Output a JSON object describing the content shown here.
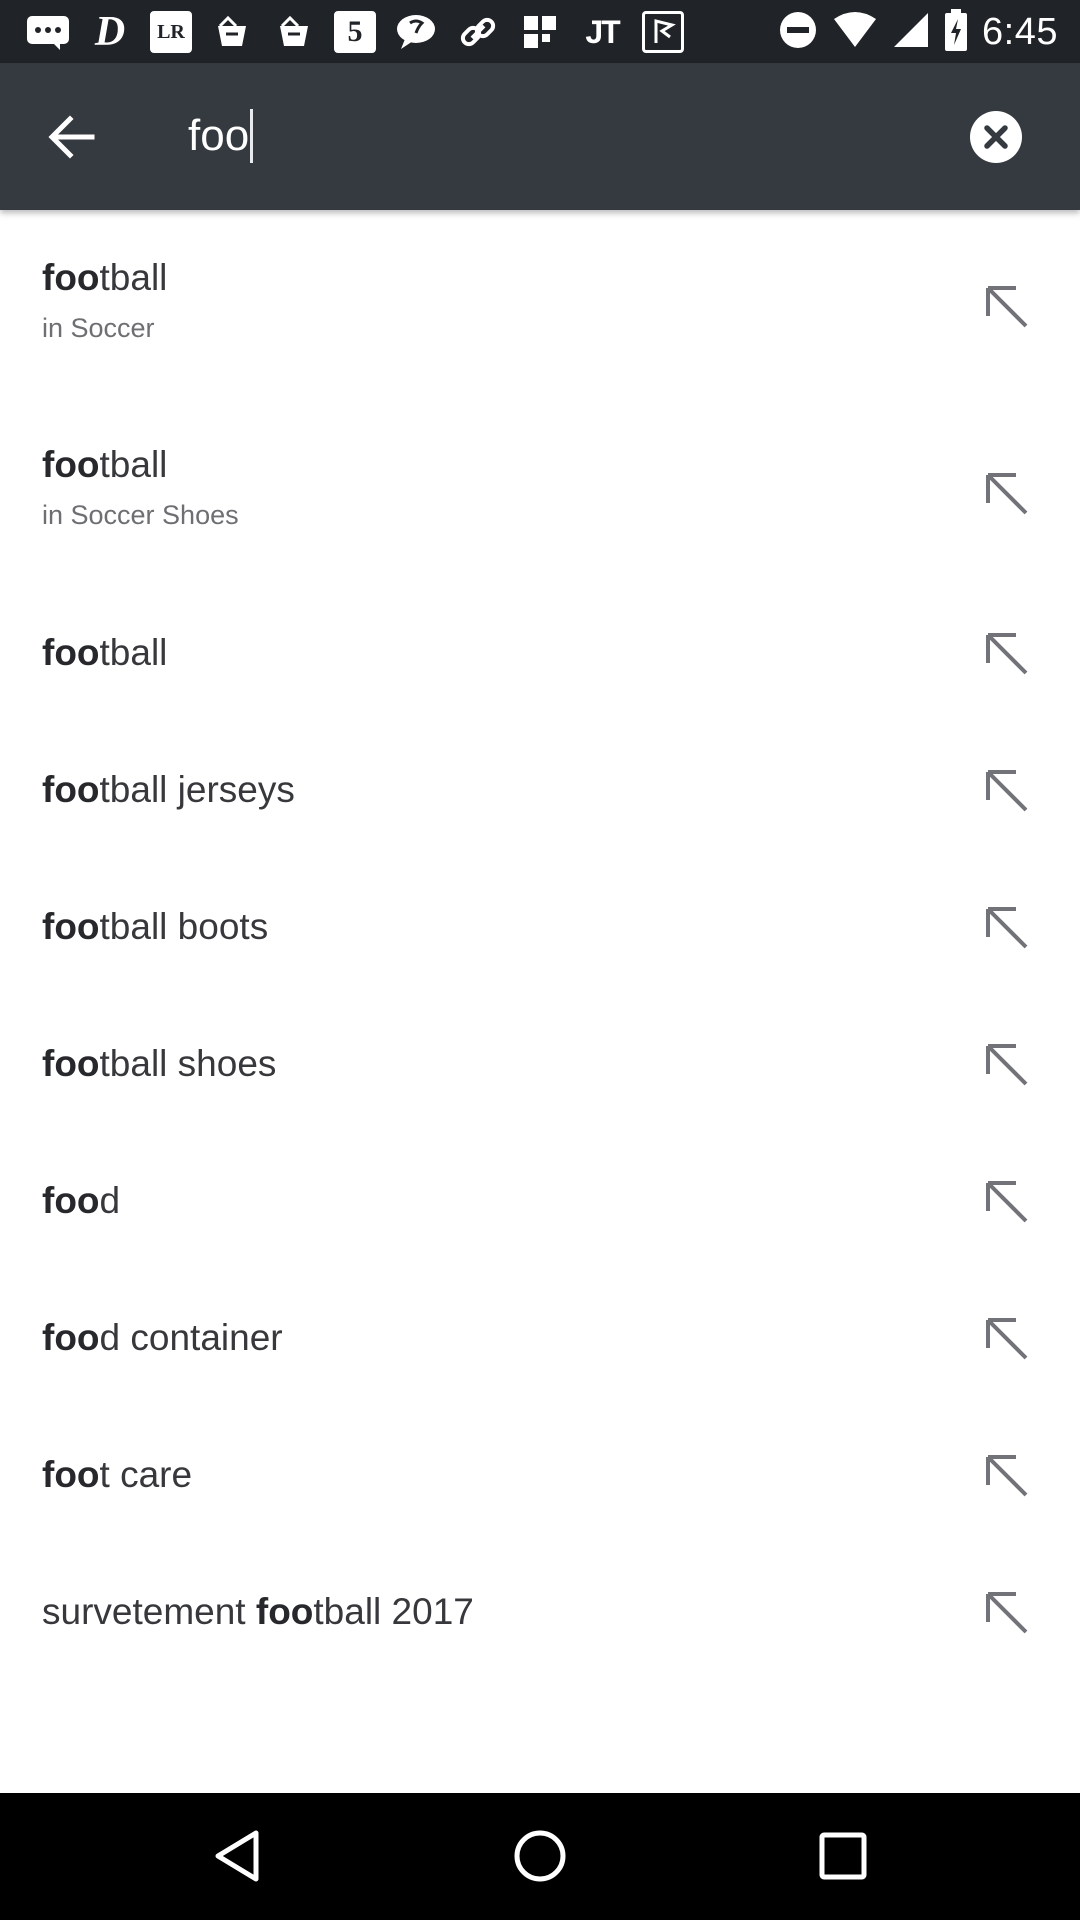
{
  "status_bar": {
    "time": "6:45",
    "notification_icons": [
      "messages-icon",
      "d-app-icon",
      "lr-app-icon",
      "shop-app-icon",
      "shop-app-icon",
      "5-app-icon",
      "chat-icon",
      "link-app-icon",
      "grid-app-icon",
      "jt-app-icon",
      "flag-app-icon"
    ],
    "notif_text": {
      "d": "D",
      "lr": "LR",
      "five": "5",
      "jt": "JT"
    }
  },
  "search": {
    "query": "foo",
    "back_icon": "arrow-back-icon",
    "clear_icon": "clear-icon"
  },
  "suggestions": [
    {
      "bold": "foo",
      "rest": "tball",
      "prefix": "",
      "category": "in Soccer"
    },
    {
      "bold": "foo",
      "rest": "tball",
      "prefix": "",
      "category": "in Soccer Shoes"
    },
    {
      "bold": "foo",
      "rest": "tball",
      "prefix": ""
    },
    {
      "bold": "foo",
      "rest": "tball jerseys",
      "prefix": ""
    },
    {
      "bold": "foo",
      "rest": "tball boots",
      "prefix": ""
    },
    {
      "bold": "foo",
      "rest": "tball shoes",
      "prefix": ""
    },
    {
      "bold": "foo",
      "rest": "d",
      "prefix": ""
    },
    {
      "bold": "foo",
      "rest": "d container",
      "prefix": ""
    },
    {
      "bold": "foo",
      "rest": "t care",
      "prefix": ""
    },
    {
      "bold": "foo",
      "rest": "tball 2017",
      "prefix": "survetement "
    }
  ],
  "colors": {
    "status_bar": "#202327",
    "toolbar": "#353a40",
    "text": "#37383c",
    "subtext": "#6d6f73",
    "fill_arrow": "#717378"
  },
  "nav_bar": {
    "back_icon": "nav-back-icon",
    "home_icon": "nav-home-icon",
    "recents_icon": "nav-recents-icon"
  }
}
